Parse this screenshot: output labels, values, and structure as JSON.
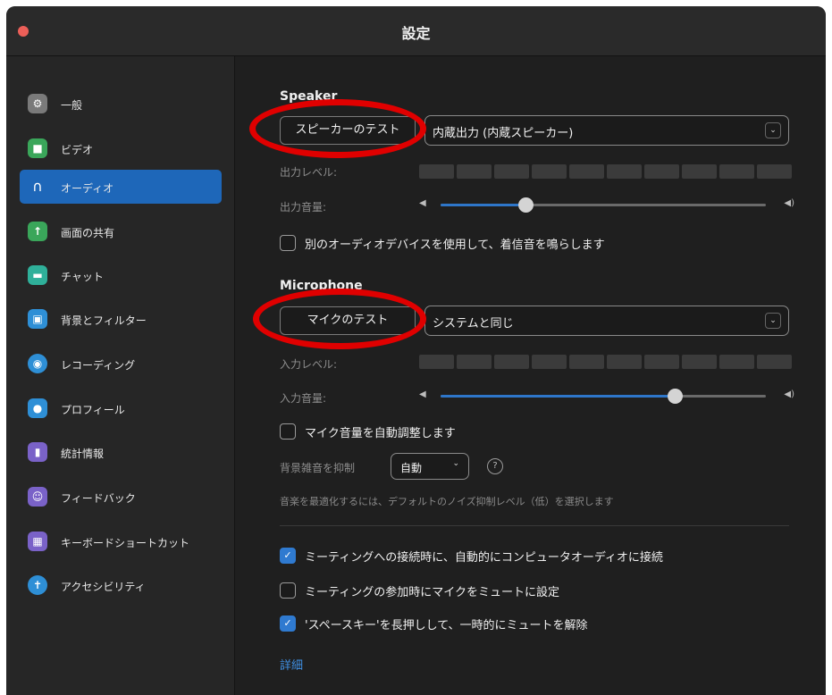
{
  "window": {
    "title": "設定"
  },
  "sidebar": {
    "items": [
      {
        "label": "一般",
        "icon": "gear-icon",
        "color": "#7a7a7a",
        "glyph": "⚙"
      },
      {
        "label": "ビデオ",
        "icon": "video-camera-icon",
        "color": "#3aa65a",
        "glyph": "■"
      },
      {
        "label": "オーディオ",
        "icon": "headphones-icon",
        "color": "",
        "glyph": "∩"
      },
      {
        "label": "画面の共有",
        "icon": "share-screen-icon",
        "color": "#3aa65a",
        "glyph": "↑"
      },
      {
        "label": "チャット",
        "icon": "chat-bubble-icon",
        "color": "#2fb09a",
        "glyph": "▬"
      },
      {
        "label": "背景とフィルター",
        "icon": "background-icon",
        "color": "#2e8fd6",
        "glyph": "▣"
      },
      {
        "label": "レコーディング",
        "icon": "record-icon",
        "color": "#2e8fd6",
        "glyph": "◉"
      },
      {
        "label": "プロフィール",
        "icon": "profile-icon",
        "color": "#2e8fd6",
        "glyph": "●"
      },
      {
        "label": "統計情報",
        "icon": "statistics-icon",
        "color": "#7a62c8",
        "glyph": "▮"
      },
      {
        "label": "フィードバック",
        "icon": "feedback-icon",
        "color": "#7a62c8",
        "glyph": "☺"
      },
      {
        "label": "キーボードショートカット",
        "icon": "keyboard-icon",
        "color": "#7a62c8",
        "glyph": "▦"
      },
      {
        "label": "アクセシビリティ",
        "icon": "accessibility-icon",
        "color": "#2e8fd6",
        "glyph": "✝"
      }
    ],
    "active_index": 2,
    "active_color": "#1e67b9"
  },
  "speaker": {
    "title": "Speaker",
    "test_button": "スピーカーのテスト",
    "device": "内蔵出力 (内蔵スピーカー)",
    "output_level_label": "出力レベル:",
    "output_volume_label": "出力音量:",
    "volume": 0.26,
    "separate_device_label": "別のオーディオデバイスを使用して、着信音を鳴らします",
    "separate_device_checked": false
  },
  "microphone": {
    "title": "Microphone",
    "test_button": "マイクのテスト",
    "device": "システムと同じ",
    "input_level_label": "入力レベル:",
    "input_volume_label": "入力音量:",
    "volume": 0.72,
    "auto_adjust_label": "マイク音量を自動調整します",
    "auto_adjust_checked": false,
    "noise_label": "背景雑音を抑制",
    "noise_value": "自動",
    "noise_hint": "音楽を最適化するには、デフォルトのノイズ抑制レベル（低）を選択します"
  },
  "options": [
    {
      "label": "ミーティングへの接続時に、自動的にコンピュータオーディオに接続",
      "checked": true
    },
    {
      "label": "ミーティングの参加時にマイクをミュートに設定",
      "checked": false
    },
    {
      "label": "'スペースキー'を長押しして、一時的にミュートを解除",
      "checked": true
    }
  ],
  "advanced_link": "詳細",
  "check_glyph": "✓",
  "chevron_glyph": "⌄",
  "help_glyph": "?",
  "vol_low_glyph": "◀",
  "vol_high_glyph": "◀)",
  "accent_color": "#2f7ad0",
  "annotation_color": "#e00000"
}
